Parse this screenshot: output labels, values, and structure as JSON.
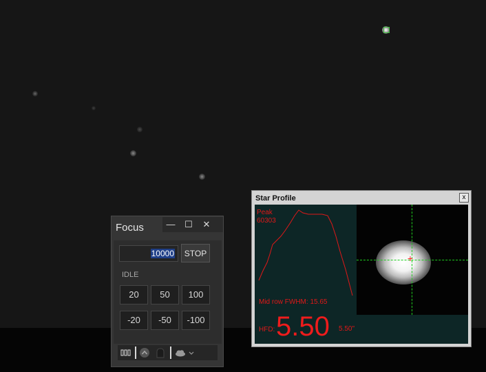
{
  "focus_window": {
    "title": "Focus",
    "controls": {
      "minimize": "—",
      "maximize": "☐",
      "close": "✕"
    },
    "step_input": {
      "value": "10000"
    },
    "stop_label": "STOP",
    "status": "IDLE",
    "move_buttons_positive": [
      "20",
      "50",
      "100"
    ],
    "move_buttons_negative": [
      "-20",
      "-50",
      "-100"
    ],
    "toolbar_icons": [
      "counter-icon",
      "arrow-up-icon",
      "lock-icon",
      "cloud-icon",
      "dropdown-arrow-icon"
    ]
  },
  "star_profile": {
    "title": "Star Profile",
    "close_label": "x",
    "peak_label": "Peak",
    "peak_value": "60303",
    "fwhm_text": "Mid row FWHM: 15.65",
    "hfd_label": "HFD:",
    "hfd_value": "5.50",
    "hfd_arcsec": "5.50\""
  },
  "colors": {
    "sky_background": "#161616",
    "profile_red": "#e01818",
    "crosshair_green": "#1ecf1e",
    "guide_box_green": "#3fbf3f"
  }
}
